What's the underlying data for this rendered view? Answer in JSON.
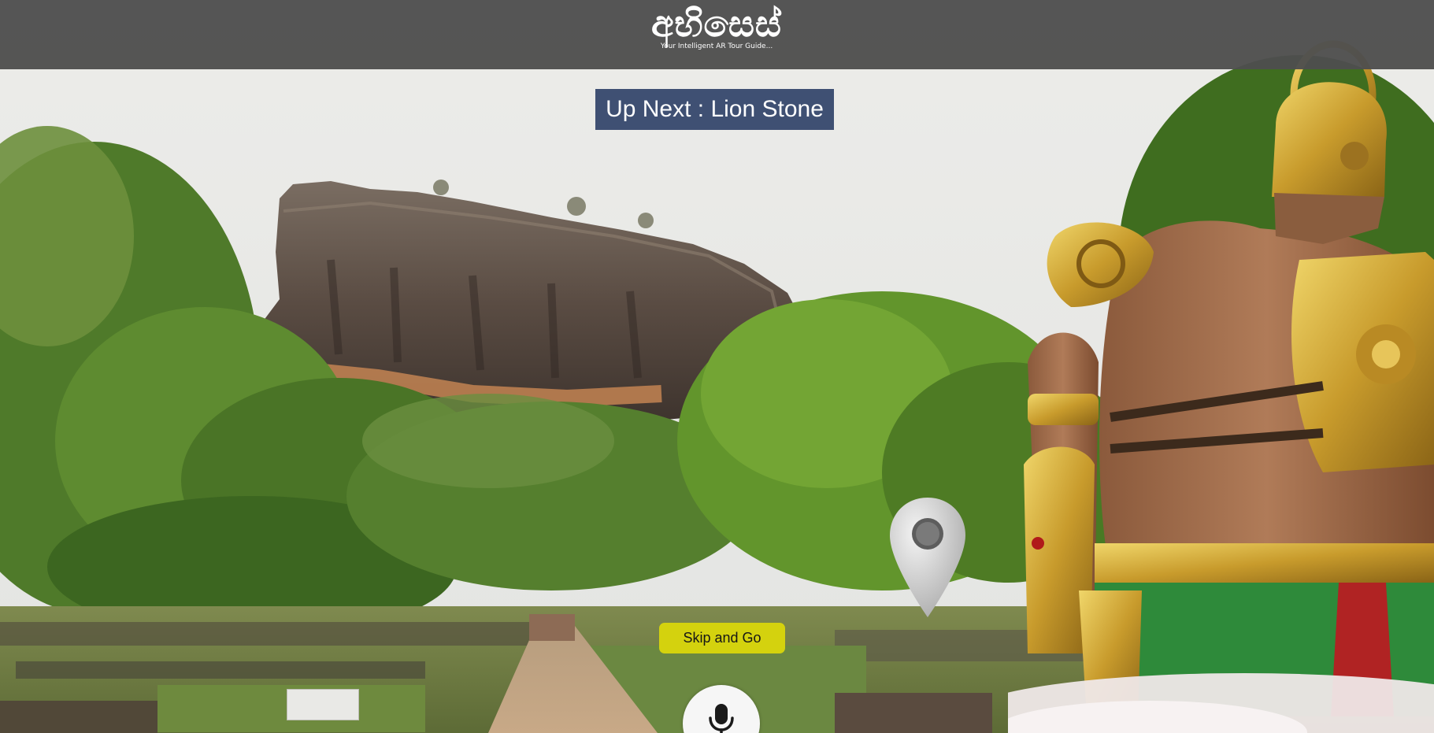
{
  "header": {
    "logo_title": "අභිසෙස්",
    "logo_tagline": "Your Intelligent AR Tour Guide..."
  },
  "tour": {
    "up_next_label": "Up Next : Lion Stone",
    "skip_button_label": "Skip and Go"
  },
  "controls": {
    "mic_icon": "microphone-icon",
    "location_icon": "map-pin-icon"
  },
  "colors": {
    "header_bg": "#4e4e4e",
    "up_next_bg": "#324469",
    "skip_button_bg": "#d4d20e",
    "mic_button_bg": "#f6f6f6"
  }
}
